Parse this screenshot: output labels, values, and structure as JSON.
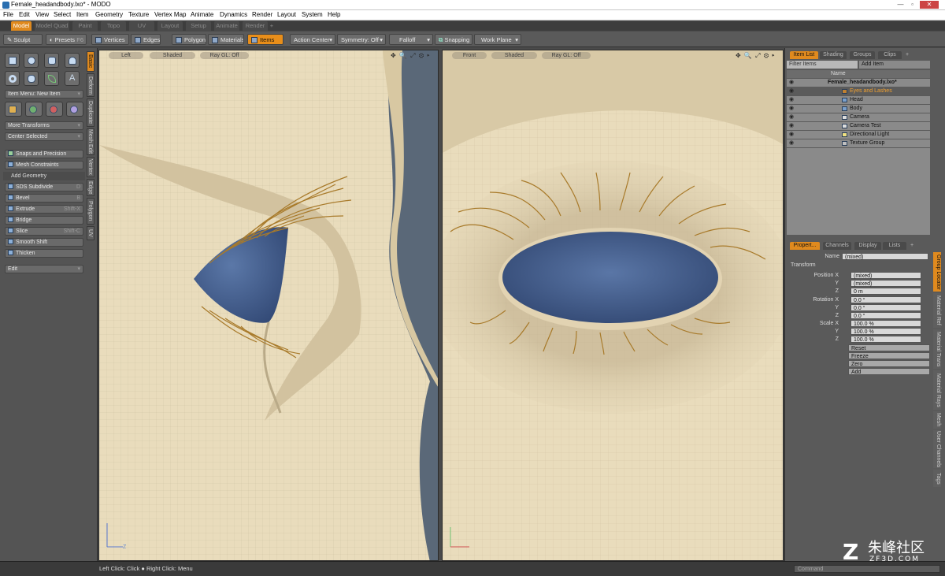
{
  "window": {
    "title": "Female_headandbody.lxo* - MODO"
  },
  "menu": [
    "File",
    "Edit",
    "View",
    "Select",
    "Item",
    "Geometry",
    "Texture",
    "Vertex Map",
    "Animate",
    "Dynamics",
    "Render",
    "Layout",
    "System",
    "Help"
  ],
  "layout_tabs": [
    {
      "label": "Model",
      "active": true
    },
    {
      "label": "Model Quad",
      "active": false
    },
    {
      "label": "Paint",
      "active": false
    },
    {
      "label": "Topo",
      "active": false
    },
    {
      "label": "UV",
      "active": false
    },
    {
      "label": "Layout",
      "active": false
    },
    {
      "label": "Setup",
      "active": false
    },
    {
      "label": "Animate",
      "active": false
    },
    {
      "label": "Render",
      "active": false
    },
    {
      "label": "+",
      "active": false
    }
  ],
  "toolbar": {
    "sculpt": "Sculpt",
    "presets": "Presets",
    "presets_key": "F6",
    "vertices": "Vertices",
    "edges": "Edges",
    "polygons": "Polygons",
    "materials": "Materials",
    "items": "Items",
    "action_center": "Action Center",
    "symmetry": "Symmetry: Off",
    "falloff": "Falloff",
    "snapping": "Snapping",
    "work_plane": "Work Plane"
  },
  "left_panel": {
    "item_menu": "Item Menu: New Item",
    "more_transforms": "More Transforms",
    "center_selected": "Center Selected",
    "snaps": "Snaps and Precision",
    "constraints": "Mesh Constraints",
    "add_geometry": "Add Geometry",
    "tools": [
      {
        "label": "SDS Subdivide",
        "key": "D"
      },
      {
        "label": "Bevel",
        "key": "B"
      },
      {
        "label": "Extrude",
        "key": "Shift-X"
      },
      {
        "label": "Bridge",
        "key": ""
      },
      {
        "label": "Slice",
        "key": "Shift-C"
      },
      {
        "label": "Smooth Shift",
        "key": ""
      },
      {
        "label": "Thicken",
        "key": ""
      }
    ],
    "edit": "Edit",
    "vtabs": [
      "Basic",
      "Deform",
      "Duplicate",
      "Mesh Edit",
      "Vertex",
      "Edge",
      "Polygon",
      "UV"
    ]
  },
  "viewport_left": {
    "view": "Left",
    "shading": "Shaded",
    "raygl": "Ray GL: Off",
    "axis_label": "Z"
  },
  "viewport_right": {
    "view": "Front",
    "shading": "Shaded",
    "raygl": "Ray GL: Off"
  },
  "right_panel": {
    "tabs": [
      "Item List",
      "Shading",
      "Groups",
      "Clips",
      "+"
    ],
    "filter": "Filter Items",
    "add_item": "Add Item",
    "name_col": "Name",
    "items": [
      {
        "label": "Female_headandbody.lxo*",
        "selected": false,
        "indent": 0
      },
      {
        "label": "Eyes and Lashes",
        "selected": true,
        "indent": 1
      },
      {
        "label": "Head",
        "selected": false,
        "indent": 1
      },
      {
        "label": "Body",
        "selected": false,
        "indent": 1
      },
      {
        "label": "Camera",
        "selected": false,
        "indent": 1
      },
      {
        "label": "Camera Test",
        "selected": false,
        "indent": 1
      },
      {
        "label": "Directional Light",
        "selected": false,
        "indent": 1
      },
      {
        "label": "Texture Group",
        "selected": false,
        "indent": 1
      }
    ],
    "prop_tabs": [
      "Propert...",
      "Channels",
      "Display",
      "Lists",
      "+"
    ],
    "name_label": "Name",
    "name_value": "(mixed)",
    "transform": "Transform",
    "position": {
      "label": "Position X",
      "y": "Y",
      "z": "Z",
      "vx": "(mixed)",
      "vy": "(mixed)",
      "vz": "0 m"
    },
    "rotation": {
      "label": "Rotation X",
      "y": "Y",
      "z": "Z",
      "vx": "0.0 °",
      "vy": "0.0 °",
      "vz": "0.0 °"
    },
    "scale": {
      "label": "Scale X",
      "y": "Y",
      "z": "Z",
      "vx": "100.0 %",
      "vy": "100.0 %",
      "vz": "100.0 %"
    },
    "buttons": [
      "Reset",
      "Freeze",
      "Zero",
      "Add"
    ],
    "side_tabs": [
      "Group Locator",
      "Material Ref",
      "Material Trans",
      "Material Rays",
      "Mesh",
      "User Channels",
      "Tags"
    ]
  },
  "status": {
    "hint": "Left Click: Click ● Right Click: Menu",
    "command": "Command"
  },
  "watermark": {
    "glyph": "Z",
    "cn": "朱峰社区",
    "en": "ZF3D.COM"
  },
  "colors": {
    "accent": "#e08a1e",
    "viewport": "#e6d8b8",
    "eye": "#3f5a86",
    "lashes": "#a87a2a"
  }
}
